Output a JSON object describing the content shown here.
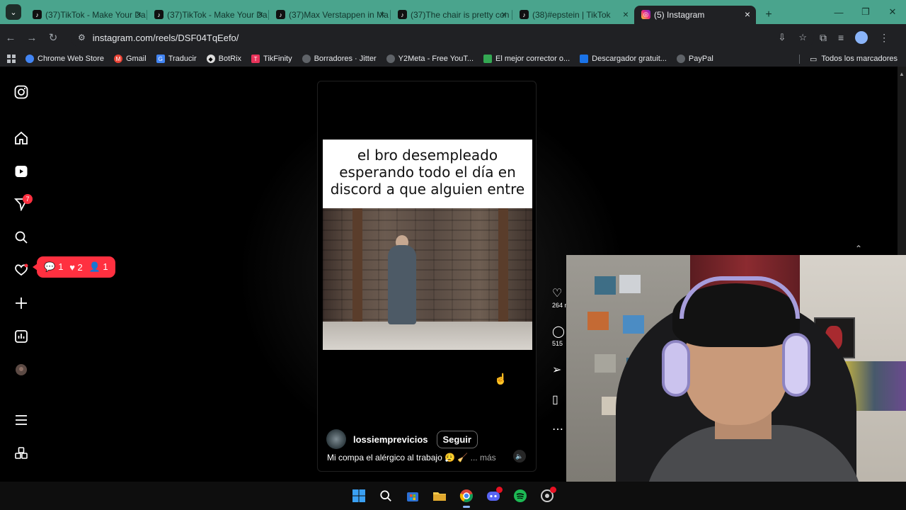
{
  "browser": {
    "tabs": [
      {
        "title": "(37)TikTok - Make Your Da",
        "active": false
      },
      {
        "title": "(37)TikTok - Make Your Da",
        "active": false
      },
      {
        "title": "(37)Max Verstappen in Ma",
        "active": false
      },
      {
        "title": "(37)The chair is pretty con",
        "active": false
      },
      {
        "title": "(38)#epstein | TikTok",
        "active": false
      },
      {
        "title": "(5) Instagram",
        "active": true
      }
    ],
    "url": "instagram.com/reels/DSF04TqEefo/"
  },
  "bookmarks": {
    "items": [
      {
        "label": "Chrome Web Store",
        "color": "#4285f4"
      },
      {
        "label": "Gmail",
        "color": "#ea4335"
      },
      {
        "label": "Traducir",
        "color": "#4285f4"
      },
      {
        "label": "BotRix",
        "color": "#ffffff"
      },
      {
        "label": "TikFinity",
        "color": "#e8335a"
      },
      {
        "label": "Borradores · Jitter",
        "color": "#9aa0a6"
      },
      {
        "label": "Y2Meta - Free YouT...",
        "color": "#9aa0a6"
      },
      {
        "label": "El mejor corrector o...",
        "color": "#34a853"
      },
      {
        "label": "Descargador gratuit...",
        "color": "#1a73e8"
      },
      {
        "label": "PayPal",
        "color": "#9aa0a6"
      }
    ],
    "all_label": "Todos los marcadores"
  },
  "sidebar": {
    "reels_badge": "7",
    "notification_counts": {
      "comments": "1",
      "likes": "2",
      "follows": "1"
    }
  },
  "reel": {
    "overlay_text_line1": "el bro desempleado",
    "overlay_text_line2": "esperando todo el día en",
    "overlay_text_line3": "discord a que alguien entre",
    "username": "lossiemprevicios",
    "follow_label": "Seguir",
    "caption": "Mi compa el alérgico al trabajo 😮‍💨 🧹",
    "more_label": "... más",
    "likes": "264 m",
    "comments": "515"
  },
  "colors": {
    "tabbar": "#4aa48d",
    "notification": "#ff3040",
    "background": "#000000"
  }
}
